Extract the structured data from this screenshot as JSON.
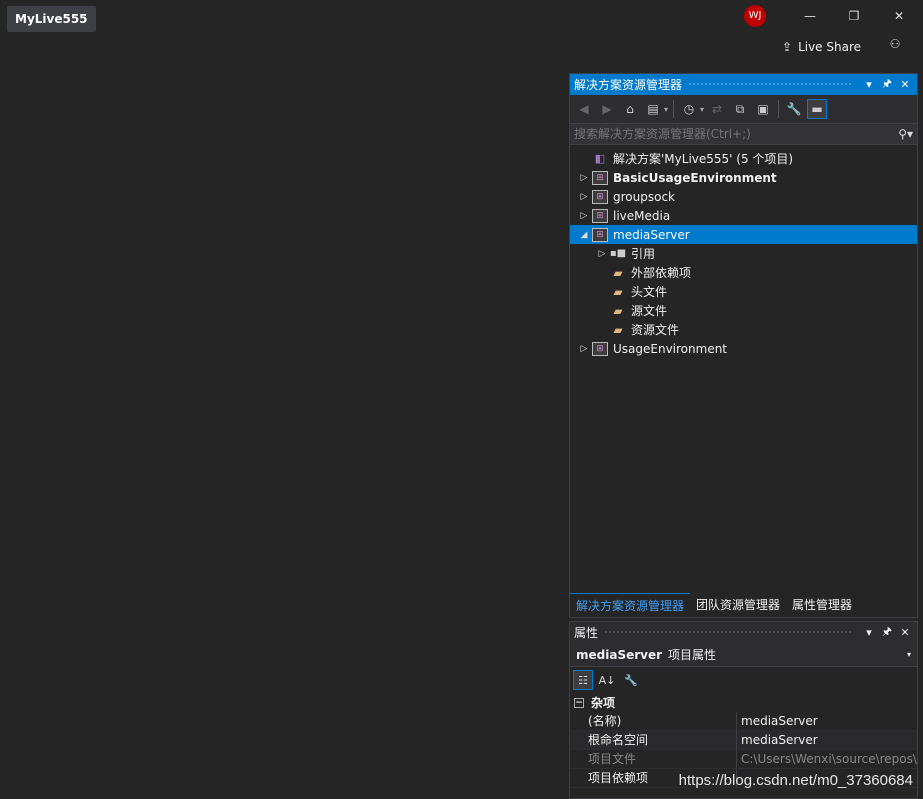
{
  "app": {
    "title": "MyLive555"
  },
  "account": {
    "initials": "WJ",
    "avatar_color": "#c00000"
  },
  "window_controls": {
    "minimize": "—",
    "restore": "❐",
    "close": "✕"
  },
  "live_share": {
    "label": "Live Share"
  },
  "solution_explorer": {
    "title": "解决方案资源管理器",
    "search_placeholder": "搜索解决方案资源管理器(Ctrl+;)",
    "tree": [
      {
        "label": "解决方案'MyLive555' (5 个项目)",
        "icon": "solution-icon"
      },
      {
        "label": "BasicUsageEnvironment",
        "icon": "project-icon",
        "bold": true
      },
      {
        "label": "groupsock",
        "icon": "project-icon"
      },
      {
        "label": "liveMedia",
        "icon": "project-icon"
      },
      {
        "label": "mediaServer",
        "icon": "project-icon",
        "selected": true,
        "expanded": true
      },
      {
        "label": "引用",
        "icon": "references-icon"
      },
      {
        "label": "外部依赖项",
        "icon": "external-dependencies-icon"
      },
      {
        "label": "头文件",
        "icon": "folder-icon"
      },
      {
        "label": "源文件",
        "icon": "folder-icon"
      },
      {
        "label": "资源文件",
        "icon": "folder-icon"
      },
      {
        "label": "UsageEnvironment",
        "icon": "project-icon"
      }
    ],
    "bottom_tabs": [
      "解决方案资源管理器",
      "团队资源管理器",
      "属性管理器"
    ]
  },
  "properties": {
    "title": "属性",
    "object_name": "mediaServer",
    "object_type": "项目属性",
    "category": "杂项",
    "rows": [
      {
        "key": "(名称)",
        "value": "mediaServer"
      },
      {
        "key": "根命名空间",
        "value": "mediaServer"
      },
      {
        "key": "项目文件",
        "value": "C:\\Users\\Wenxi\\source\\repos\\"
      },
      {
        "key": "项目依赖项",
        "value": ""
      }
    ]
  },
  "watermark": "https://blog.csdn.net/m0_37360684",
  "colors": {
    "accent": "#007acc",
    "background": "#252526",
    "selection": "#007acc"
  }
}
